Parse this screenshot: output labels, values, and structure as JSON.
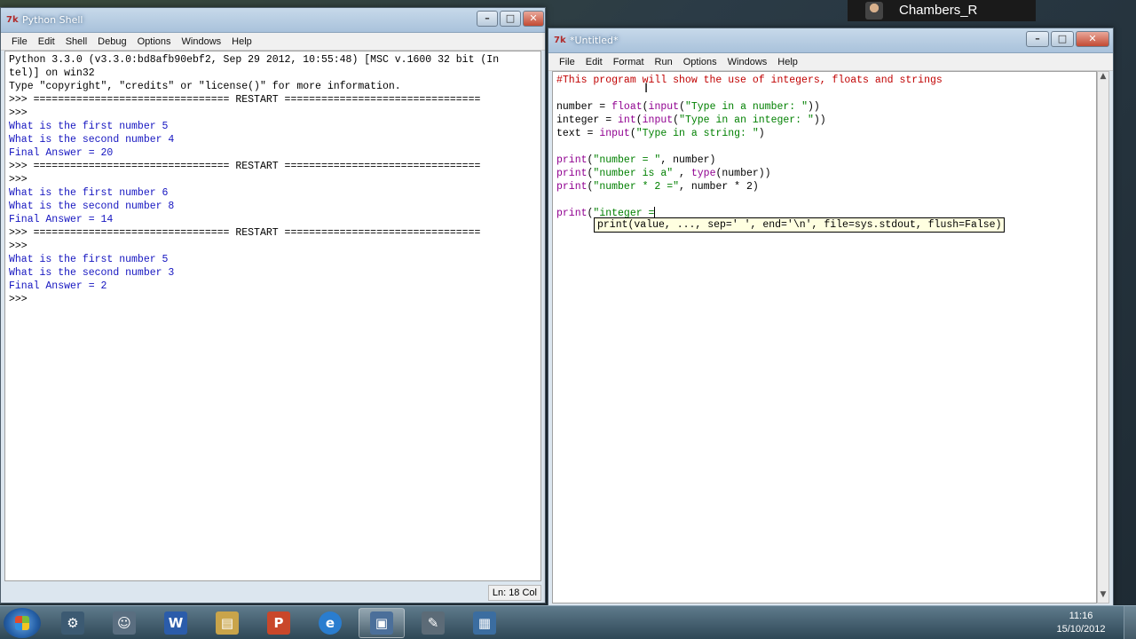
{
  "user": {
    "name": "Chambers_R"
  },
  "shell": {
    "title": "Python Shell",
    "menu": [
      "File",
      "Edit",
      "Shell",
      "Debug",
      "Options",
      "Windows",
      "Help"
    ],
    "status": "Ln: 18 Col",
    "lines": [
      {
        "t": "Python 3.3.0 (v3.3.0:bd8afb90ebf2, Sep 29 2012, 10:55:48) [MSC v.1600 32 bit (In",
        "c": ""
      },
      {
        "t": "tel)] on win32",
        "c": ""
      },
      {
        "t": "Type \"copyright\", \"credits\" or \"license()\" for more information.",
        "c": ""
      },
      {
        "t": ">>> ================================ RESTART ================================",
        "c": ""
      },
      {
        "t": ">>>",
        "c": ""
      },
      {
        "t": "What is the first number 5",
        "c": "out"
      },
      {
        "t": "What is the second number 4",
        "c": "out"
      },
      {
        "t": "Final Answer = 20",
        "c": "out"
      },
      {
        "t": ">>> ================================ RESTART ================================",
        "c": ""
      },
      {
        "t": ">>>",
        "c": ""
      },
      {
        "t": "What is the first number 6",
        "c": "out"
      },
      {
        "t": "What is the second number 8",
        "c": "out"
      },
      {
        "t": "Final Answer = 14",
        "c": "out"
      },
      {
        "t": ">>> ================================ RESTART ================================",
        "c": ""
      },
      {
        "t": ">>>",
        "c": ""
      },
      {
        "t": "What is the first number 5",
        "c": "out"
      },
      {
        "t": "What is the second number 3",
        "c": "out"
      },
      {
        "t": "Final Answer = 2",
        "c": "out"
      },
      {
        "t": ">>>",
        "c": ""
      }
    ]
  },
  "editor": {
    "title": "*Untitled*",
    "menu": [
      "File",
      "Edit",
      "Format",
      "Run",
      "Options",
      "Windows",
      "Help"
    ],
    "lines": [
      "#This program will show the use of integers, floats and strings",
      "",
      "number = float(input(\"Type in a number: \"))",
      "integer = int(input(\"Type in an integer: \"))",
      "text = input(\"Type in a string: \")",
      "",
      "print(\"number = \", number)",
      "print(\"number is a\" , type(number))",
      "print(\"number * 2 =\", number * 2)",
      "",
      "print(\"integer ="
    ],
    "calltip": "print(value, ..., sep=' ', end='\\n', file=sys.stdout, flush=False)"
  },
  "taskbar": {
    "apps": [
      "python-shell",
      "user-manager",
      "word",
      "file-explorer",
      "powerpoint",
      "internet-explorer",
      "idle-editor",
      "python-tool",
      "remote-desktop"
    ],
    "clock_time": "11:16",
    "clock_date": "15/10/2012"
  },
  "colors": {
    "comment": "#c00000",
    "string": "#008000",
    "builtin": "#900090",
    "output": "#1515c0"
  }
}
